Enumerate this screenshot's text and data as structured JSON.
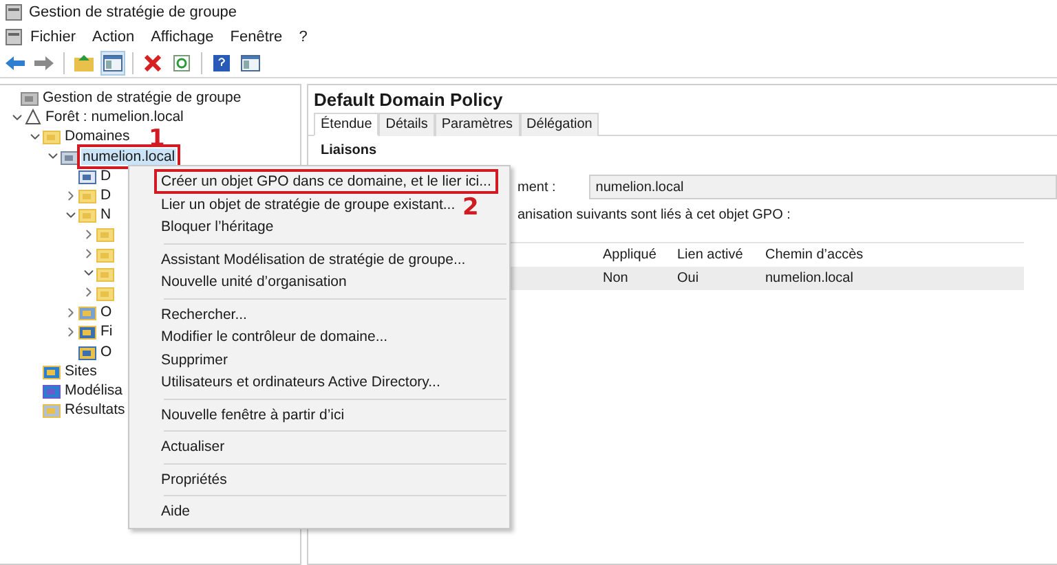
{
  "window": {
    "title": "Gestion de stratégie de groupe"
  },
  "menubar": [
    "Fichier",
    "Action",
    "Affichage",
    "Fenêtre",
    "?"
  ],
  "toolbar": [
    {
      "kind": "back"
    },
    {
      "kind": "forward"
    },
    {
      "kind": "sep"
    },
    {
      "kind": "folder"
    },
    {
      "kind": "pane",
      "selected": true
    },
    {
      "kind": "sep"
    },
    {
      "kind": "delete"
    },
    {
      "kind": "refresh"
    },
    {
      "kind": "sep"
    },
    {
      "kind": "help"
    },
    {
      "kind": "pane2"
    }
  ],
  "tree": [
    {
      "label": "Gestion de stratégie de groupe",
      "kind": "console",
      "children": [
        {
          "label": "Forêt : numelion.local",
          "kind": "forest",
          "expanded": true,
          "children": [
            {
              "label": "Domaines",
              "kind": "folder",
              "expanded": true,
              "children": [
                {
                  "label": "numelion.local",
                  "kind": "domain",
                  "expanded": true,
                  "selected": true,
                  "annotation": "1",
                  "children": [
                    {
                      "label": "D",
                      "kind": "gpo"
                    },
                    {
                      "label": "D",
                      "kind": "folder",
                      "expanded": false
                    },
                    {
                      "label": "N",
                      "kind": "folder",
                      "expanded": true,
                      "children": [
                        {
                          "kind": "folder",
                          "expanded": false
                        },
                        {
                          "kind": "folder",
                          "expanded": false
                        },
                        {
                          "kind": "folder",
                          "expanded": true
                        },
                        {
                          "kind": "folder",
                          "expanded": false
                        }
                      ]
                    },
                    {
                      "label": "O",
                      "kind": "objects",
                      "expanded": false
                    },
                    {
                      "label": "Fi",
                      "kind": "filter",
                      "expanded": false
                    },
                    {
                      "label": "O",
                      "kind": "starter"
                    }
                  ]
                }
              ]
            },
            {
              "label": "Sites",
              "kind": "sites"
            },
            {
              "label": "Modélisa",
              "kind": "model"
            },
            {
              "label": "Résultats",
              "kind": "results"
            }
          ]
        }
      ]
    }
  ],
  "detail": {
    "title": "Default Domain Policy",
    "tabs": [
      {
        "label": "Étendue",
        "selected": true
      },
      {
        "label": "Détails",
        "selected": false
      },
      {
        "label": "Paramètres",
        "selected": false
      },
      {
        "label": "Délégation",
        "selected": false
      }
    ],
    "section": "Liaisons",
    "location_label": "ment :",
    "location_value": "numelion.local",
    "caption": "anisation suivants sont liés à cet objet GPO :",
    "columns": [
      "Appliqué",
      "Lien activé",
      "Chemin d’accès"
    ],
    "rows": [
      [
        "Non",
        "Oui",
        "numelion.local"
      ]
    ]
  },
  "context_menu": [
    [
      {
        "label": "Créer un objet GPO dans ce domaine, et le lier ici...",
        "annotation": "2"
      },
      {
        "label": "Lier un objet de stratégie de groupe existant..."
      },
      {
        "label": "Bloquer l’héritage"
      }
    ],
    [
      {
        "label": "Assistant Modélisation de stratégie de groupe..."
      },
      {
        "label": "Nouvelle unité d’organisation"
      }
    ],
    [
      {
        "label": "Rechercher..."
      },
      {
        "label": "Modifier le contrôleur de domaine..."
      },
      {
        "label": "Supprimer"
      },
      {
        "label": "Utilisateurs et ordinateurs Active Directory..."
      }
    ],
    [
      {
        "label": "Nouvelle fenêtre à partir d’ici"
      }
    ],
    [
      {
        "label": "Actualiser"
      }
    ],
    [
      {
        "label": "Propriétés"
      }
    ],
    [
      {
        "label": "Aide"
      }
    ]
  ]
}
